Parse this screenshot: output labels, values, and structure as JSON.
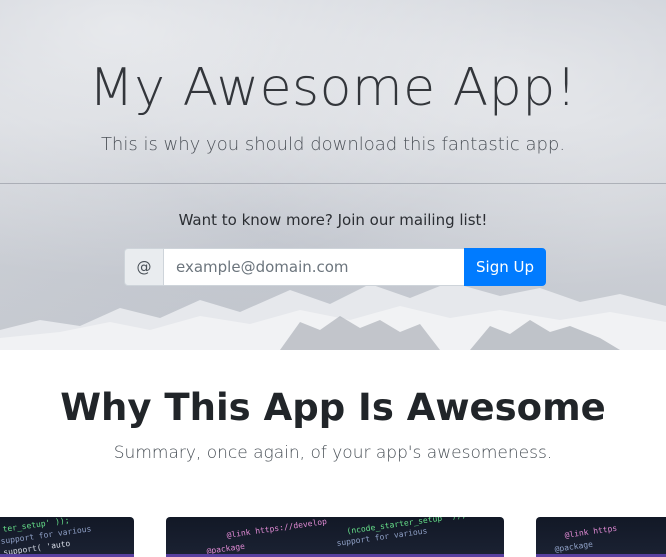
{
  "hero": {
    "title": "My Awesome App!",
    "subtitle": "This is why you should download this fantastic app.",
    "mailing_label": "Want to know more? Join our mailing list!",
    "at_symbol": "@",
    "email_placeholder": "example@domain.com",
    "signup_label": "Sign Up"
  },
  "features": {
    "title": "Why This App Is Awesome",
    "subtitle": "Summary, once again, of your app's awesomeness."
  },
  "colors": {
    "primary": "#007bff",
    "heading": "#212529",
    "card_bg": "#121826"
  }
}
